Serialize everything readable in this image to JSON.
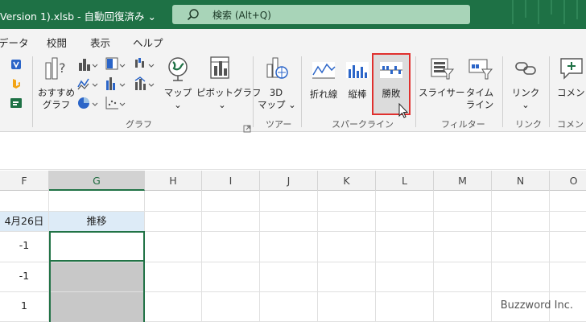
{
  "title": {
    "document": "Version 1).xlsb  -  自動回復済み  ⌄",
    "search_placeholder": "検索 (Alt+Q)",
    "icons": [
      "search-icon"
    ]
  },
  "menu": {
    "tabs": [
      "データ",
      "校閲",
      "表示",
      "ヘルプ"
    ]
  },
  "ribbon": {
    "buttons": {
      "recommended_chart": "おすすめ\nグラフ",
      "map": "マップ",
      "pivot_chart": "ピボットグラフ",
      "map3d": "3D\nマップ",
      "line": "折れ線",
      "column": "縦棒",
      "win_loss": "勝敗",
      "slicer": "スライサー",
      "timeline": "タイム\nライン",
      "link": "リンク",
      "comment": "コメント"
    },
    "groups": {
      "chart": "グラフ",
      "tour": "ツアー",
      "sparkline": "スパークライン",
      "filter": "フィルター",
      "link": "リンク",
      "comment": "コメント"
    },
    "accent_color": "#217346",
    "highlight_color": "#e0302e"
  },
  "sheet": {
    "columns": [
      "F",
      "G",
      "H",
      "I",
      "J",
      "K",
      "L",
      "M",
      "N",
      "O"
    ],
    "selected_column": "G",
    "header_row": {
      "F": "4月26日",
      "G": "推移"
    },
    "f_values": [
      "-1",
      "-1",
      "1"
    ]
  },
  "watermark": "Buzzword Inc."
}
